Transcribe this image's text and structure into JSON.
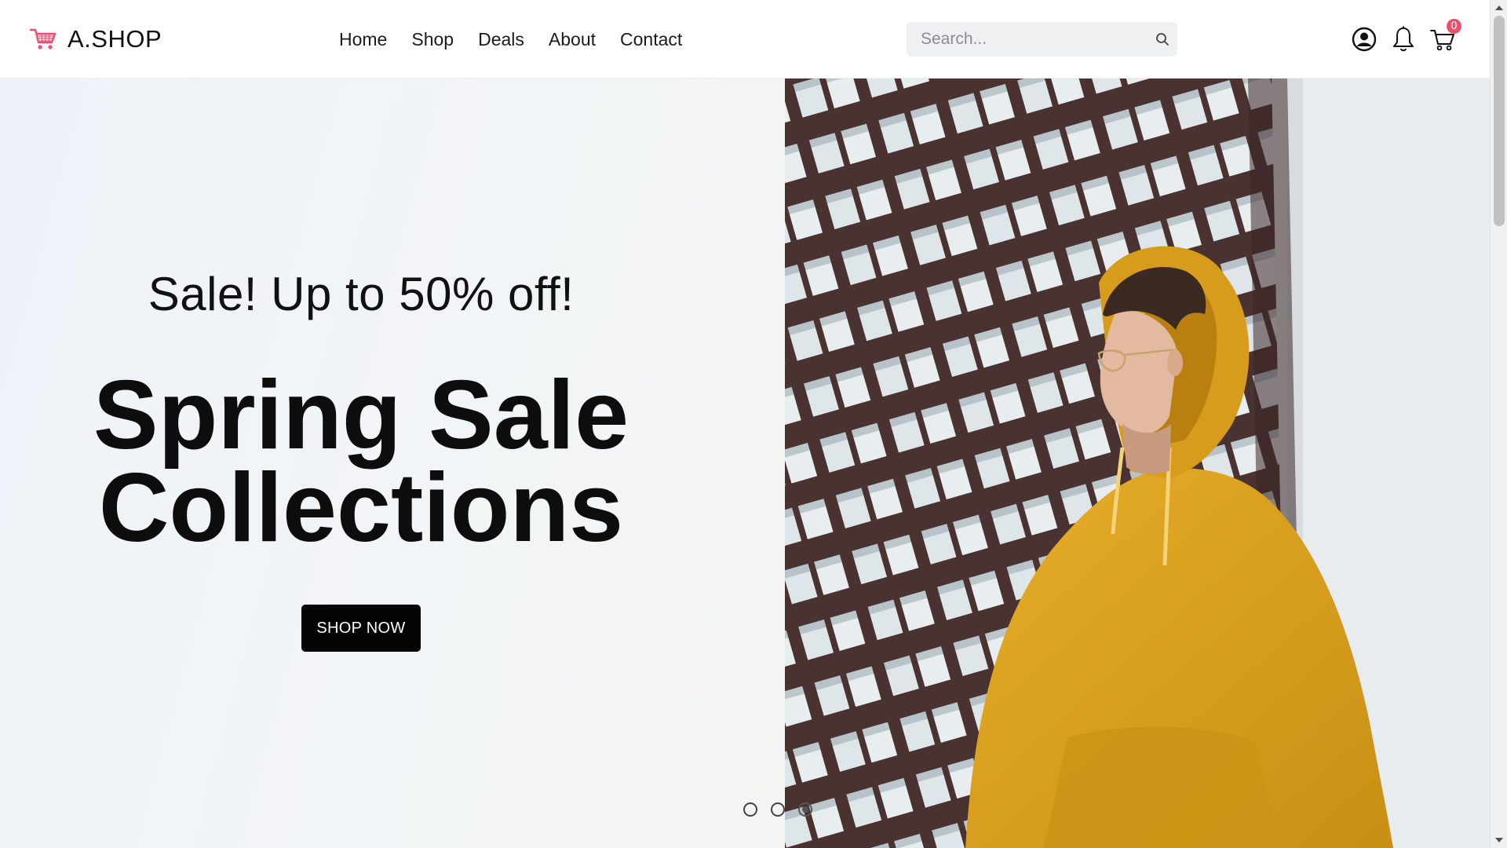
{
  "header": {
    "brand_name": "A.SHOP",
    "brand_icon": "shopping-cart-icon",
    "nav": [
      {
        "label": "Home"
      },
      {
        "label": "Shop"
      },
      {
        "label": "Deals"
      },
      {
        "label": "About"
      },
      {
        "label": "Contact"
      }
    ],
    "search": {
      "placeholder": "Search...",
      "value": "",
      "icon": "search-icon"
    },
    "icons": [
      "user-account-icon",
      "notification-bell-icon",
      "cart-icon"
    ],
    "cart_count": "0",
    "colors": {
      "brand_accent": "#ef4f6e",
      "badge": "#ef4f6e"
    }
  },
  "hero": {
    "subtitle": "Sale! Up to 50% off!",
    "title_line1": "Spring Sale",
    "title_line2": "Collections",
    "cta_label": "SHOP NOW",
    "image": "man-in-yellow-hoodie-photo",
    "slides": {
      "count": 3,
      "active_index": 2
    },
    "colors": {
      "button_bg": "#050505",
      "hoodie": "#e0a41e"
    }
  }
}
